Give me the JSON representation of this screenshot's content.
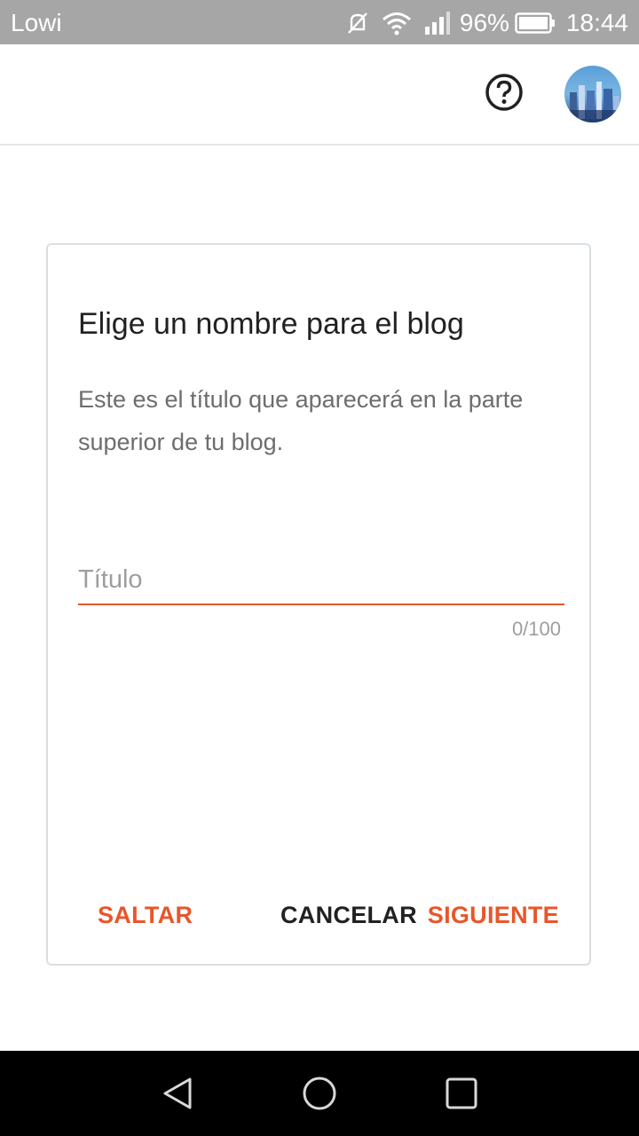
{
  "status_bar": {
    "carrier": "Lowi",
    "battery": "96%",
    "time": "18:44",
    "icons": [
      "mute-icon",
      "wifi-icon",
      "signal-icon",
      "battery-icon"
    ]
  },
  "app_bar": {
    "help_icon": "help-circle-icon",
    "avatar": "user-avatar"
  },
  "dialog": {
    "title": "Elige un nombre para el blog",
    "description": "Este es el título que aparecerá en la parte superior de tu blog.",
    "input": {
      "placeholder": "Título",
      "value": ""
    },
    "counter": "0/100",
    "buttons": {
      "skip": "SALTAR",
      "cancel": "CANCELAR",
      "next": "SIGUIENTE"
    }
  },
  "colors": {
    "accent": "#e8562a",
    "status_bar": "#a6a6a6",
    "text": "#212121",
    "secondary_text": "#6d6d6d"
  },
  "nav_bar": {
    "icons": [
      "back-icon",
      "home-icon",
      "recents-icon"
    ]
  }
}
